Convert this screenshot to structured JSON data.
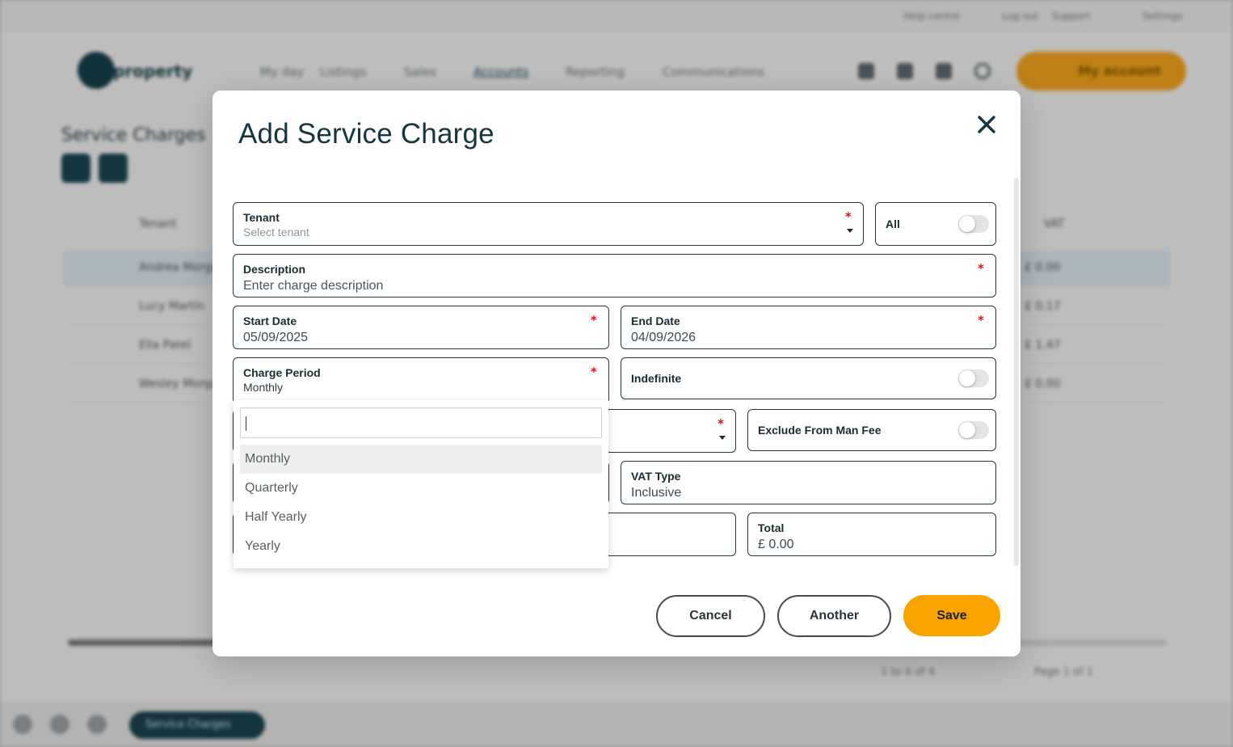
{
  "background": {
    "top_links": [
      "Help centre",
      "Log out",
      "Support",
      "Settings"
    ],
    "logo_text": "property",
    "nav": [
      "My day",
      "Listings",
      "Sales",
      "Accounts",
      "Reporting",
      "Communications"
    ],
    "account_button": "My account",
    "page_title": "Service Charges",
    "rows": [
      "Andrea Morgan",
      "Lucy Martin",
      "Ella Patel",
      "Wesley Morgan"
    ],
    "row_values": [
      "£ 0.00",
      "£ 0.17",
      "£ 1.47",
      "£ 0.00"
    ],
    "column_tenant": "Tenant",
    "column_vat": "VAT",
    "pager_count": "1 to 4 of 4",
    "pager_page": "Page 1 of 1",
    "bottom_pill": "Service Charges"
  },
  "modal": {
    "title": "Add Service Charge",
    "tenant": {
      "label": "Tenant",
      "placeholder": "Select tenant"
    },
    "all_toggle": {
      "label": "All",
      "on": false
    },
    "description": {
      "label": "Description",
      "placeholder": "Enter charge description"
    },
    "start_date": {
      "label": "Start Date",
      "value": "05/09/2025"
    },
    "end_date": {
      "label": "End Date",
      "value": "04/09/2026"
    },
    "charge_period": {
      "label": "Charge Period",
      "value": "Monthly"
    },
    "indefinite_toggle": {
      "label": "Indefinite",
      "on": false
    },
    "exclude_toggle": {
      "label": "Exclude From Man Fee",
      "on": false
    },
    "vat_type": {
      "label": "VAT Type",
      "value": "Inclusive"
    },
    "total": {
      "label": "Total",
      "value": "£ 0.00"
    },
    "required_mark": "*",
    "dropdown": {
      "search_value": "",
      "options": [
        "Monthly",
        "Quarterly",
        "Half Yearly",
        "Yearly"
      ],
      "highlighted": "Monthly"
    },
    "buttons": {
      "cancel": "Cancel",
      "another": "Another",
      "save": "Save"
    }
  },
  "colors": {
    "primary": "#f8a300",
    "title": "#153540",
    "border": "#1f3a44",
    "required": "#d0181f"
  }
}
